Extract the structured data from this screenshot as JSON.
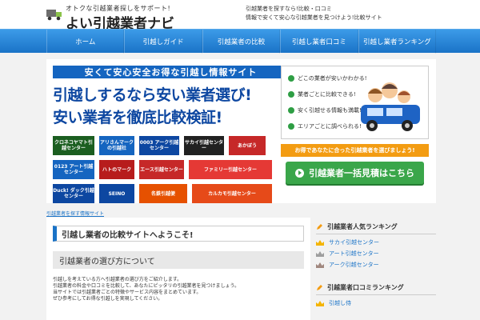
{
  "header": {
    "tagline": "オトクな引越業者探しをサポート!",
    "site_title": "よい引越業者ナビ",
    "desc_line1": "引越業者を探すなら!比較・口コミ",
    "desc_line2": "情報で安くて安心な引越業者を見つけよう!比較サイト"
  },
  "nav": {
    "items": [
      {
        "label": "ホーム"
      },
      {
        "label": "引越しガイド"
      },
      {
        "label": "引越業者の比較"
      },
      {
        "label": "引越し業者口コミ"
      },
      {
        "label": "引越し業者ランキング"
      }
    ]
  },
  "banner": {
    "ribbon": "安くて安心安全お得な引越し情報サイト",
    "headline1": "引越しするなら安い業者選び!",
    "headline2": "安い業者を徹底比較検証!",
    "companies": [
      {
        "name": "クロネコヤマト引越センター",
        "color": "#1b5e20"
      },
      {
        "name": "アリさんマークの引越社",
        "color": "#1565c0"
      },
      {
        "name": "0003 アーク引越センター",
        "color": "#0d47a1"
      },
      {
        "name": "サカイ引越センター",
        "color": "#212121"
      },
      {
        "name": "あかぼう",
        "color": "#c62828"
      },
      {
        "name": "0123 アート引越センター",
        "color": "#1565c0"
      },
      {
        "name": "ハトのマーク",
        "color": "#b71c1c"
      },
      {
        "name": "エース引越センター",
        "color": "#c62828"
      },
      {
        "name": "ファミリー引越センター",
        "color": "#e53935"
      },
      {
        "name": "Duck! ダック引越センター",
        "color": "#0d47a1"
      },
      {
        "name": "SEINO",
        "color": "#0d47a1"
      },
      {
        "name": "名鉄引越便",
        "color": "#e65100"
      },
      {
        "name": "カルカモ引越センター",
        "color": "#e64a19"
      }
    ],
    "checks": [
      "どこの業者が安いかわかる!",
      "業者ごとに比較できる!",
      "安く引越せる情報も満載!",
      "エリアごとに調べられる!"
    ],
    "cta_strip": "お得であなたに合った引越業者を選びましょう!",
    "cta_button": "引越業者一括見積はこちら"
  },
  "breadcrumb": "引越業者を探す情報サイト",
  "main": {
    "title": "引越し業者の比較サイトへようこそ!",
    "subtitle": "引越業者の選び方について",
    "paragraphs": [
      "引越しを考えている方へ引越業者の選び方をご紹介します。",
      "引越業者の料金や口コミを比較して、あなたにピッタリの引越業者を見つけましょう。",
      "当サイトでは引越業者ごとの特徴やサービス内容をまとめています。",
      "ぜひ参考にしてお得な引越しを実現してください。"
    ]
  },
  "sidebar": {
    "section1_title": "引越業者人気ランキング",
    "ranks": [
      {
        "label": "サカイ引越センター",
        "color": "#f4b400"
      },
      {
        "label": "アート引越センター",
        "color": "#9e9e9e"
      },
      {
        "label": "アーク引越センター",
        "color": "#a1887f"
      }
    ],
    "section2_title": "引越業者口コミランキング",
    "ranks2": [
      {
        "label": "引越し侍",
        "color": "#f4b400"
      }
    ]
  },
  "colors": {
    "accent": "#1a73c7",
    "cta_green": "#3aa64a",
    "cta_orange": "#f39c12"
  }
}
